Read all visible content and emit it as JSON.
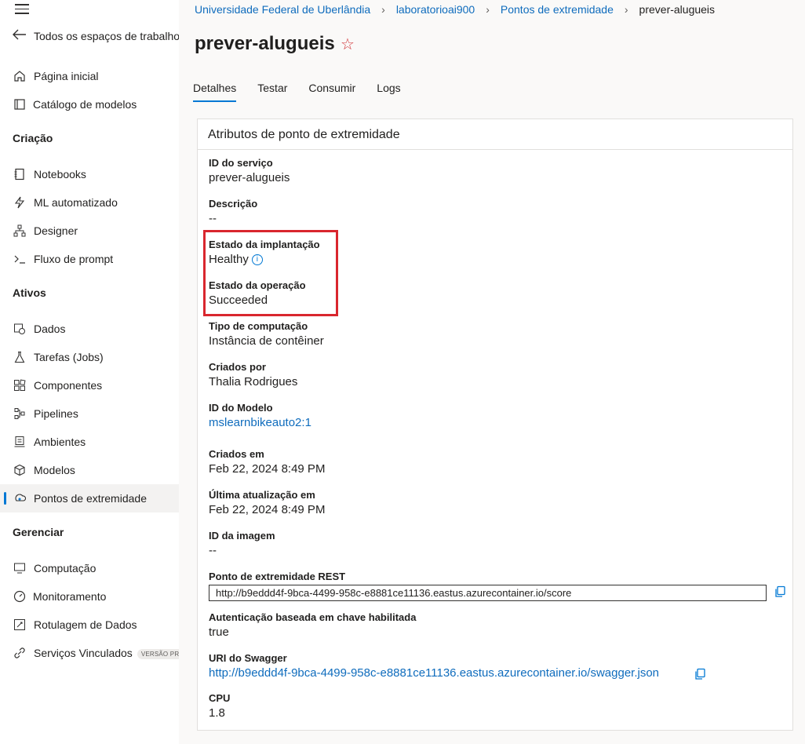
{
  "sidebar": {
    "back_label": "Todos os espaços de trabalho",
    "items_top": [
      {
        "label": "Página inicial",
        "icon": "home-icon"
      },
      {
        "label": "Catálogo de modelos",
        "icon": "catalog-icon"
      }
    ],
    "section_authoring": "Criação",
    "items_authoring": [
      {
        "label": "Notebooks",
        "icon": "notebook-icon"
      },
      {
        "label": "ML automatizado",
        "icon": "automl-icon"
      },
      {
        "label": "Designer",
        "icon": "designer-icon"
      },
      {
        "label": "Fluxo de prompt",
        "icon": "prompt-flow-icon"
      }
    ],
    "section_assets": "Ativos",
    "items_assets": [
      {
        "label": "Dados",
        "icon": "data-icon"
      },
      {
        "label": "Tarefas (Jobs)",
        "icon": "jobs-icon"
      },
      {
        "label": "Componentes",
        "icon": "components-icon"
      },
      {
        "label": "Pipelines",
        "icon": "pipelines-icon"
      },
      {
        "label": "Ambientes",
        "icon": "environments-icon"
      },
      {
        "label": "Modelos",
        "icon": "models-icon"
      },
      {
        "label": "Pontos de extremidade",
        "icon": "endpoints-icon"
      }
    ],
    "section_manage": "Gerenciar",
    "items_manage": [
      {
        "label": "Computação",
        "icon": "compute-icon"
      },
      {
        "label": "Monitoramento",
        "icon": "monitoring-icon"
      },
      {
        "label": "Rotulagem de Dados",
        "icon": "labeling-icon"
      },
      {
        "label": "Serviços Vinculados",
        "icon": "linked-services-icon",
        "badge": "VERSÃO PRÉVIA"
      }
    ]
  },
  "breadcrumb": {
    "items": [
      "Universidade Federal de Uberlândia",
      "laboratorioai900",
      "Pontos de extremidade"
    ],
    "current": "prever-alugueis"
  },
  "page_title": "prever-alugueis",
  "tabs": [
    "Detalhes",
    "Testar",
    "Consumir",
    "Logs"
  ],
  "card": {
    "title": "Atributos de ponto de extremidade",
    "props": {
      "service_id": {
        "label": "ID do serviço",
        "value": "prever-alugueis"
      },
      "description": {
        "label": "Descrição",
        "value": "--"
      },
      "deploy_state": {
        "label": "Estado da implantação",
        "value": "Healthy"
      },
      "op_state": {
        "label": "Estado da operação",
        "value": "Succeeded"
      },
      "compute_type": {
        "label": "Tipo de computação",
        "value": "Instância de contêiner"
      },
      "created_by": {
        "label": "Criados por",
        "value": "Thalia Rodrigues"
      },
      "model_id": {
        "label": "ID do Modelo",
        "value": "mslearnbikeauto2:1"
      },
      "created_on": {
        "label": "Criados em",
        "value": "Feb 22, 2024 8:49 PM"
      },
      "updated_on": {
        "label": "Última atualização em",
        "value": "Feb 22, 2024 8:49 PM"
      },
      "image_id": {
        "label": "ID da imagem",
        "value": "--"
      },
      "rest_endpoint": {
        "label": "Ponto de extremidade REST",
        "value": "http://b9eddd4f-9bca-4499-958c-e8881ce11136.eastus.azurecontainer.io/score"
      },
      "key_auth": {
        "label": "Autenticação baseada em chave habilitada",
        "value": "true"
      },
      "swagger": {
        "label": "URI do Swagger",
        "value": "http://b9eddd4f-9bca-4499-958c-e8881ce11136.eastus.azurecontainer.io/swagger.json"
      },
      "cpu": {
        "label": "CPU",
        "value": "1.8"
      }
    }
  },
  "colors": {
    "accent": "#0078d4",
    "link": "#0f6cbd",
    "highlight": "#d9262e",
    "star": "#d13438"
  }
}
